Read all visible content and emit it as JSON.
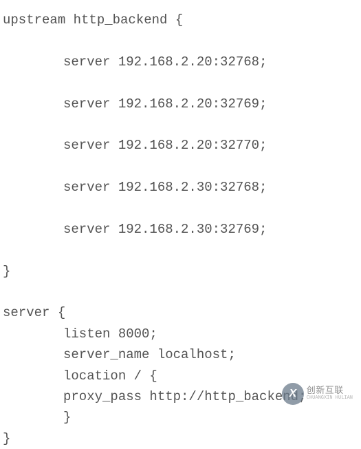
{
  "code": {
    "lines": [
      {
        "text": "upstream http_backend {",
        "indent": 0
      },
      {
        "text": "",
        "indent": 0
      },
      {
        "text": "server 192.168.2.20:32768;",
        "indent": 2
      },
      {
        "text": "",
        "indent": 0
      },
      {
        "text": "server 192.168.2.20:32769;",
        "indent": 2
      },
      {
        "text": "",
        "indent": 0
      },
      {
        "text": "server 192.168.2.20:32770;",
        "indent": 2
      },
      {
        "text": "",
        "indent": 0
      },
      {
        "text": "server 192.168.2.30:32768;",
        "indent": 2
      },
      {
        "text": "",
        "indent": 0
      },
      {
        "text": "server 192.168.2.30:32769;",
        "indent": 2
      },
      {
        "text": "",
        "indent": 0
      },
      {
        "text": "}",
        "indent": 0
      },
      {
        "text": "",
        "indent": 0
      },
      {
        "text": "server {",
        "indent": 0
      },
      {
        "text": "listen 8000;",
        "indent": 2
      },
      {
        "text": "server_name localhost;",
        "indent": 2
      },
      {
        "text": "location / {",
        "indent": 2
      },
      {
        "text": "proxy_pass http://http_backend;",
        "indent": 2
      },
      {
        "text": "}",
        "indent": 2
      },
      {
        "text": "}",
        "indent": 0
      }
    ]
  },
  "watermark": {
    "brand_short": "X",
    "brand_cn": "创新互联",
    "brand_sub": "CHUANGXIN HULIAN"
  }
}
